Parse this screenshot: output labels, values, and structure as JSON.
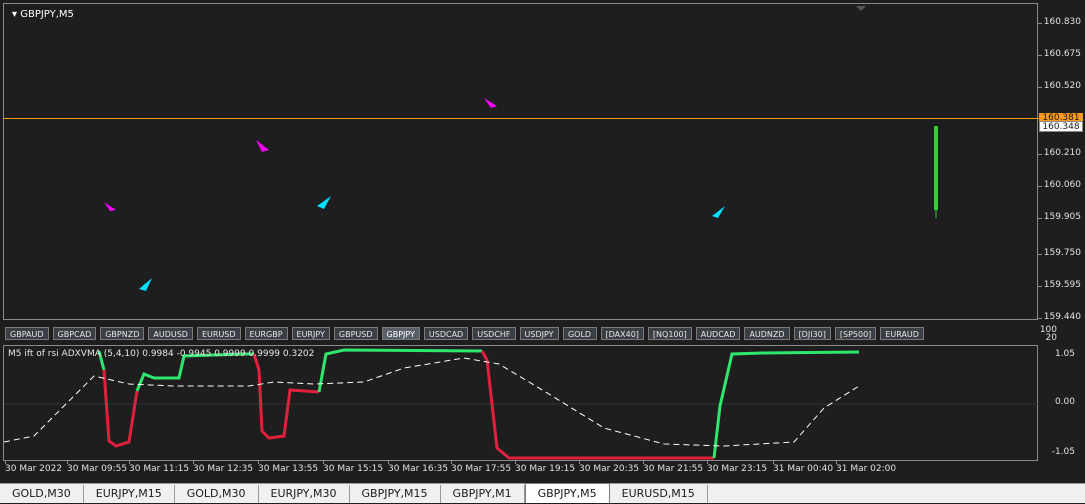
{
  "main_chart": {
    "title": "GBPJPY,M5",
    "price_axis": [
      "160.830",
      "160.675",
      "160.520",
      "160.348",
      "160.210",
      "160.060",
      "159.905",
      "159.750",
      "159.595",
      "159.440"
    ],
    "badges": {
      "orange": "160.381",
      "white": "160.348"
    },
    "colors": {
      "orange_line": "#f79a1d",
      "up_candle": "#4a90e2",
      "down_candle": "#f0a060",
      "buy_arrow": "#00e0ff",
      "sell_arrow": "#ff00ff",
      "volume_bar": "#32cd32"
    }
  },
  "symbol_bar": {
    "items": [
      "GBPAUD",
      "GBPCAD",
      "GBPNZD",
      "AUDUSD",
      "EURUSD",
      "EURGBP",
      "EURJPY",
      "GBPUSD",
      "GBPJPY",
      "USDCAD",
      "USDCHF",
      "USDJPY",
      "GOLD",
      "[DAX40]",
      "[NQ100]",
      "AUDCAD",
      "AUDNZD",
      "[DJI30]",
      "[SP500]",
      "EURAUD"
    ],
    "active": "GBPJPY"
  },
  "indicator": {
    "title": "M5 ift of rsi ADXVMA (5,4,10) 0.9984 -0.9945 0.9999 0.9999 0.3202",
    "axis": [
      "100",
      "20",
      "1.05",
      "0.00",
      "-1.05"
    ],
    "colors": {
      "up": "#2ee86e",
      "down": "#e0203c",
      "dash": "#ffffff"
    }
  },
  "time_axis": [
    "30 Mar 2022",
    "30 Mar 09:55",
    "30 Mar 11:15",
    "30 Mar 12:35",
    "30 Mar 13:55",
    "30 Mar 15:15",
    "30 Mar 16:35",
    "30 Mar 17:55",
    "30 Mar 19:15",
    "30 Mar 20:35",
    "30 Mar 21:55",
    "30 Mar 23:15",
    "31 Mar 00:40",
    "31 Mar 02:00"
  ],
  "tabs": {
    "items": [
      "GOLD,M30",
      "EURJPY,M15",
      "GOLD,M30",
      "EURJPY,M30",
      "GBPJPY,M15",
      "GBPJPY,M1",
      "GBPJPY,M5",
      "EURUSD,M15"
    ],
    "active_index": 6
  }
}
